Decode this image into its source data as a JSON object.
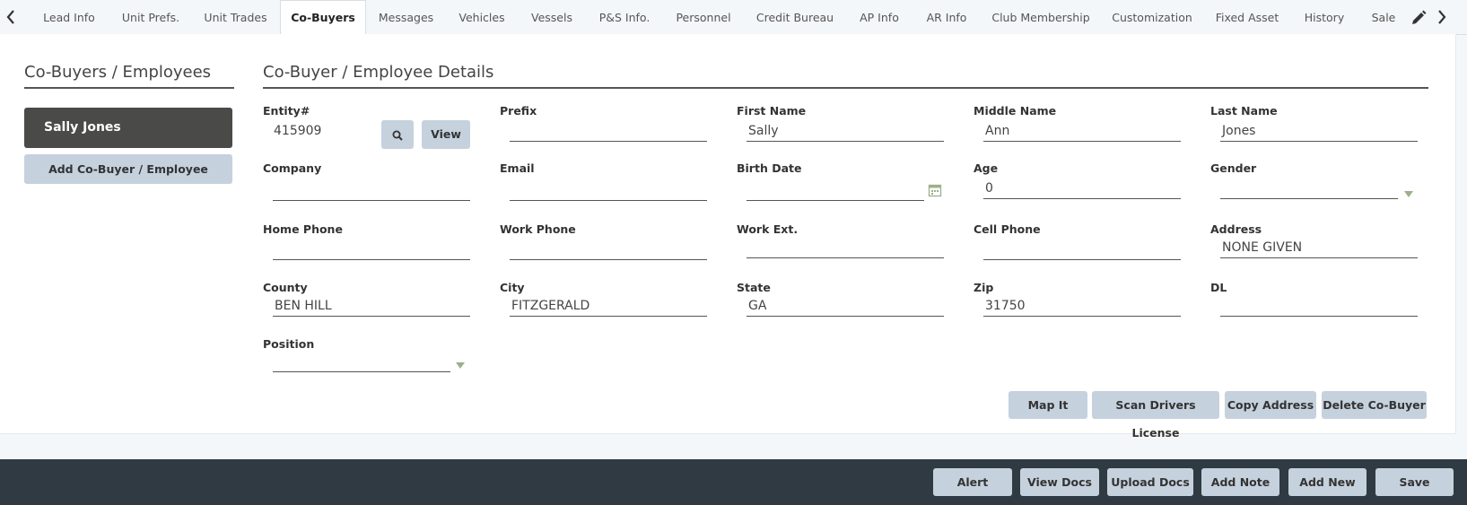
{
  "tabs": {
    "items": [
      {
        "label": "Lead Info"
      },
      {
        "label": "Unit Prefs."
      },
      {
        "label": "Unit Trades"
      },
      {
        "label": "Co-Buyers"
      },
      {
        "label": "Messages"
      },
      {
        "label": "Vehicles"
      },
      {
        "label": "Vessels"
      },
      {
        "label": "P&S Info."
      },
      {
        "label": "Personnel"
      },
      {
        "label": "Credit Bureau"
      },
      {
        "label": "AP Info"
      },
      {
        "label": "AR Info"
      },
      {
        "label": "Club Membership"
      },
      {
        "label": "Customization"
      },
      {
        "label": "Fixed Asset"
      },
      {
        "label": "History"
      },
      {
        "label": "Sale"
      }
    ],
    "active": "Co-Buyers"
  },
  "left": {
    "title": "Co-Buyers / Employees",
    "selected": "Sally Jones",
    "add_button": "Add Co-Buyer / Employee"
  },
  "details": {
    "title": "Co-Buyer / Employee Details",
    "entity_label": "Entity#",
    "entity_value": "415909",
    "view_button": "View",
    "prefix_label": "Prefix",
    "prefix_value": "",
    "first_label": "First Name",
    "first_value": "Sally",
    "middle_label": "Middle Name",
    "middle_value": "Ann",
    "last_label": "Last Name",
    "last_value": "Jones",
    "company_label": "Company",
    "company_value": "",
    "email_label": "Email",
    "email_value": "",
    "birth_label": "Birth Date",
    "birth_value": "",
    "age_label": "Age",
    "age_value": "0",
    "gender_label": "Gender",
    "gender_value": "",
    "home_label": "Home Phone",
    "home_value": "",
    "work_label": "Work Phone",
    "work_value": "",
    "ext_label": "Work Ext.",
    "ext_value": "",
    "cell_label": "Cell Phone",
    "cell_value": "",
    "address_label": "Address",
    "address_value": "NONE GIVEN",
    "county_label": "County",
    "county_value": "BEN HILL",
    "city_label": "City",
    "city_value": "FITZGERALD",
    "state_label": "State",
    "state_value": "GA",
    "zip_label": "Zip",
    "zip_value": "31750",
    "dl_label": "DL",
    "dl_value": "",
    "position_label": "Position",
    "position_value": "",
    "actions": {
      "map": "Map It",
      "scan": "Scan Drivers License",
      "copy": "Copy Address",
      "delete": "Delete Co-Buyer"
    }
  },
  "footer": {
    "alert": "Alert",
    "view_docs": "View Docs",
    "upload_docs": "Upload Docs",
    "add_note": "Add Note",
    "add_new": "Add New",
    "save": "Save"
  },
  "colors": {
    "dark_button": "#4a4a48",
    "light_button": "#c6d1de",
    "footer_bg": "#2f3a43",
    "dropdown_arrow": "#9db089"
  }
}
